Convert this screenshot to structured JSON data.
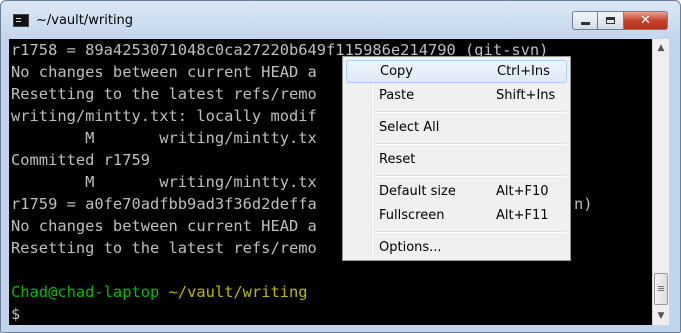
{
  "window": {
    "title": "~/vault/writing"
  },
  "title_buttons": {
    "minimize": "minimize",
    "maximize": "maximize",
    "close": "✕"
  },
  "terminal": {
    "lines": [
      "r1758 = 89a4253071048c0ca27220b649f115986e214790 (git-svn)",
      "No changes between current HEAD a",
      "Resetting to the latest refs/remo",
      "writing/mintty.txt: locally modif",
      "        M       writing/mintty.tx",
      "Committed r1759",
      "        M       writing/mintty.tx",
      "r1759 = a0fe70adfbb9ad3f36d2deffa",
      "No changes between current HEAD a",
      "Resetting to the latest refs/remo",
      ""
    ],
    "prompt": {
      "user_host": "Chad@chad-laptop",
      "path": "~/vault/writing",
      "symbol": "$"
    },
    "line9_tail": "n)"
  },
  "context_menu": {
    "items": [
      {
        "label": "Copy",
        "accel": "Ctrl+Ins",
        "highlighted": true
      },
      {
        "label": "Paste",
        "accel": "Shift+Ins"
      },
      {
        "label": "Select All",
        "accel": ""
      },
      {
        "label": "Reset",
        "accel": ""
      },
      {
        "label": "Default size",
        "accel": "Alt+F10"
      },
      {
        "label": "Fullscreen",
        "accel": "Alt+F11"
      },
      {
        "label": "Options...",
        "accel": ""
      }
    ]
  },
  "colors": {
    "prompt_user": "#00bb00",
    "prompt_path": "#bbbb00",
    "menu_highlight": "#dde9f8"
  }
}
